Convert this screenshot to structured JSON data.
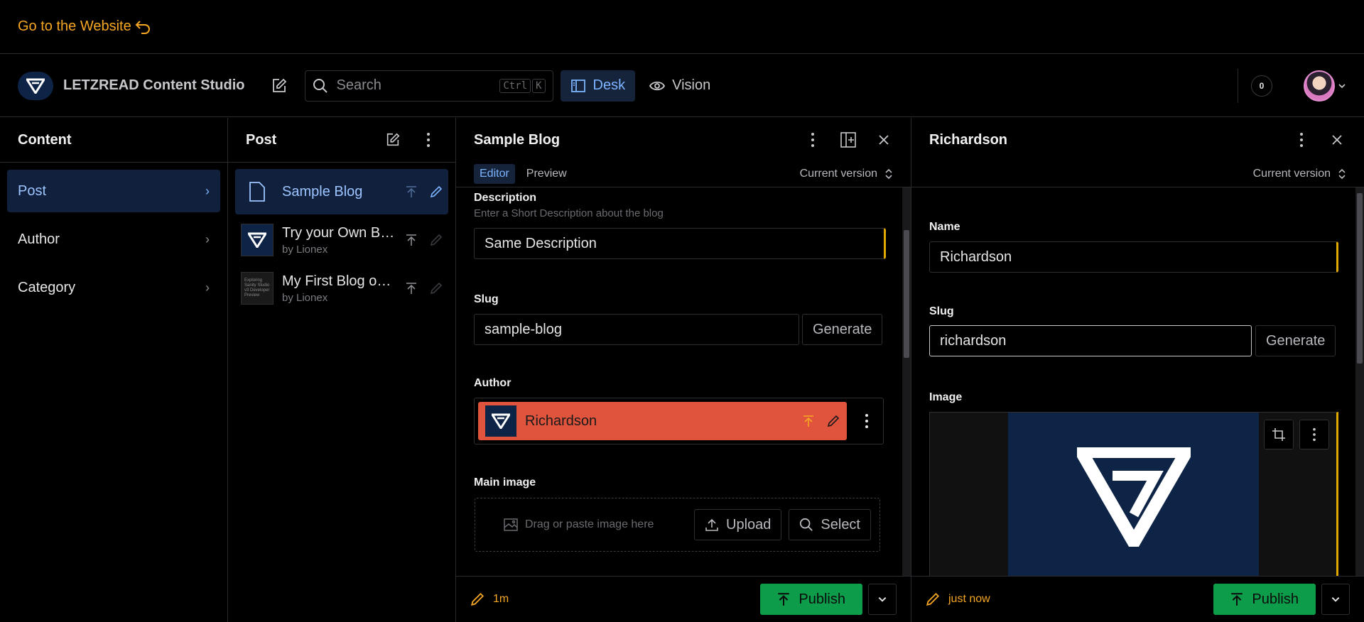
{
  "topbar": {
    "back_link": "Go to the Website"
  },
  "navbar": {
    "brand": "LETZREAD Content Studio",
    "search_placeholder": "Search",
    "shortcut_key1": "Ctrl",
    "shortcut_key2": "K",
    "desk_label": "Desk",
    "vision_label": "Vision",
    "counter": "0"
  },
  "content_pane": {
    "title": "Content",
    "items": [
      {
        "label": "Post"
      },
      {
        "label": "Author"
      },
      {
        "label": "Category"
      }
    ]
  },
  "post_pane": {
    "title": "Post",
    "items": [
      {
        "title": "Sample Blog",
        "subtitle": ""
      },
      {
        "title": "Try your Own Blog",
        "subtitle": "by Lionex"
      },
      {
        "title": "My First Blog on Sanity",
        "subtitle": "by Lionex"
      }
    ],
    "thumb_text": "Exploring Sanity Studio v3 Developer Preview"
  },
  "blog_pane": {
    "title": "Sample Blog",
    "tab_editor": "Editor",
    "tab_preview": "Preview",
    "version": "Current version",
    "description_label": "Description",
    "description_hint": "Enter a Short Description about the blog",
    "description_value": "Same Description",
    "slug_label": "Slug",
    "slug_value": "sample-blog",
    "generate": "Generate",
    "author_label": "Author",
    "author_value": "Richardson",
    "main_image_label": "Main image",
    "dropzone_text": "Drag or paste image here",
    "upload": "Upload",
    "select": "Select",
    "status_time": "1m",
    "publish": "Publish"
  },
  "author_pane": {
    "title": "Richardson",
    "version": "Current version",
    "name_label": "Name",
    "name_value": "Richardson",
    "slug_label": "Slug",
    "slug_value": "richardson",
    "generate": "Generate",
    "image_label": "Image",
    "status_time": "just now",
    "publish": "Publish"
  },
  "colors": {
    "accent": "#f5a623",
    "primary": "#7db4ff",
    "author_chip": "#e0533d",
    "publish": "#0d9c4a"
  }
}
